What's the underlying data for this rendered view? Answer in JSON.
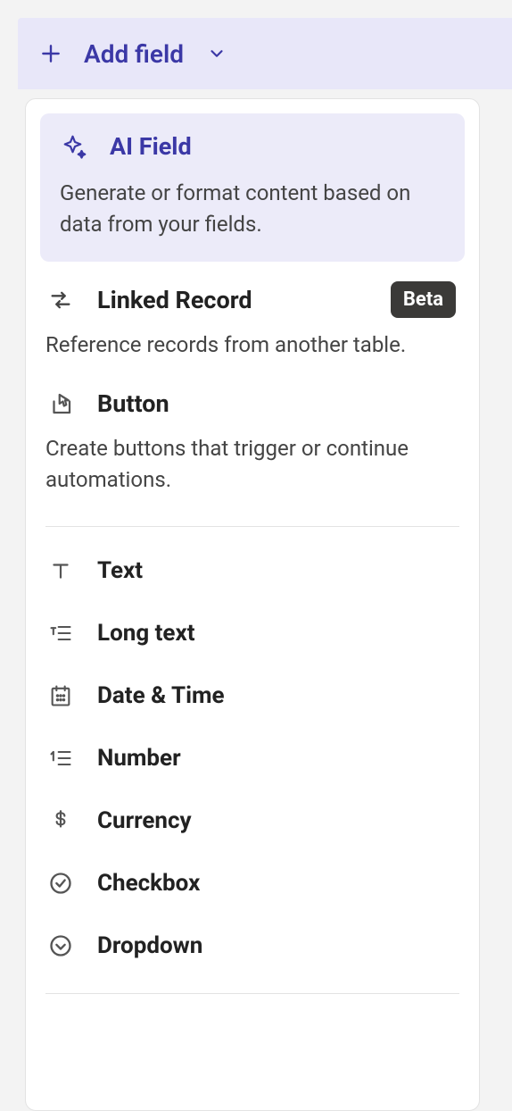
{
  "header": {
    "label": "Add field"
  },
  "featured": {
    "title": "AI Field",
    "description": "Generate or format content based on data from your fields."
  },
  "options": [
    {
      "title": "Linked Record",
      "description": "Reference records from another table.",
      "badge": "Beta"
    },
    {
      "title": "Button",
      "description": "Create buttons that trigger or continue automations."
    }
  ],
  "field_types": [
    {
      "label": "Text"
    },
    {
      "label": "Long text"
    },
    {
      "label": "Date & Time"
    },
    {
      "label": "Number"
    },
    {
      "label": "Currency"
    },
    {
      "label": "Checkbox"
    },
    {
      "label": "Dropdown"
    }
  ]
}
